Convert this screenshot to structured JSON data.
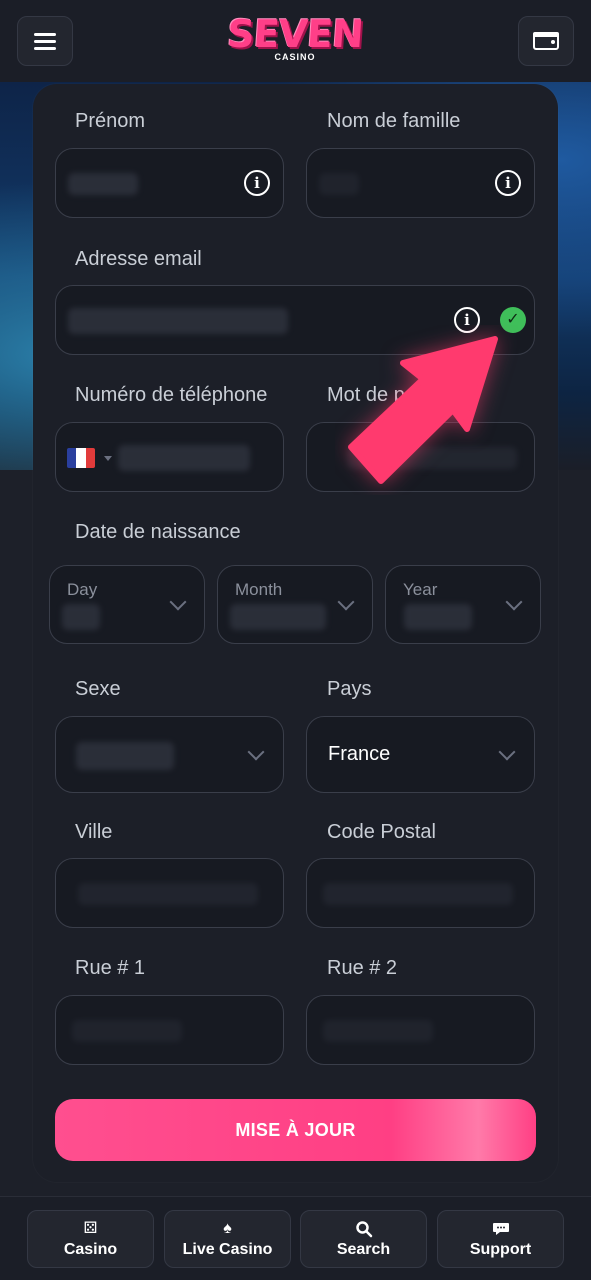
{
  "header": {
    "logo_main": "SEVEN",
    "logo_sub": "CASINO",
    "menu_icon": "hamburger-icon",
    "wallet_icon": "wallet-icon"
  },
  "form": {
    "first_name": {
      "label": "Prénom"
    },
    "last_name": {
      "label": "Nom de famille"
    },
    "email": {
      "label": "Adresse email"
    },
    "phone": {
      "label": "Numéro de téléphone",
      "country_flag": "France"
    },
    "password": {
      "label": "Mot de pa"
    },
    "birth_date": {
      "label": "Date de naissance",
      "day_placeholder": "Day",
      "month_placeholder": "Month",
      "year_placeholder": "Year"
    },
    "sex": {
      "label": "Sexe"
    },
    "country": {
      "label": "Pays",
      "value": "France"
    },
    "city": {
      "label": "Ville"
    },
    "postal_code": {
      "label": "Code Postal"
    },
    "street1": {
      "label": "Rue # 1"
    },
    "street2": {
      "label": "Rue # 2"
    },
    "submit_label": "MISE À JOUR"
  },
  "bottom_nav": [
    {
      "label": "Casino",
      "icon": "dice-icon"
    },
    {
      "label": "Live Casino",
      "icon": "cards-icon"
    },
    {
      "label": "Search",
      "icon": "search-icon"
    },
    {
      "label": "Support",
      "icon": "chat-icon"
    }
  ],
  "colors": {
    "accent": "#ff3f84",
    "success": "#3fbf5a",
    "background": "#1b1e27"
  }
}
